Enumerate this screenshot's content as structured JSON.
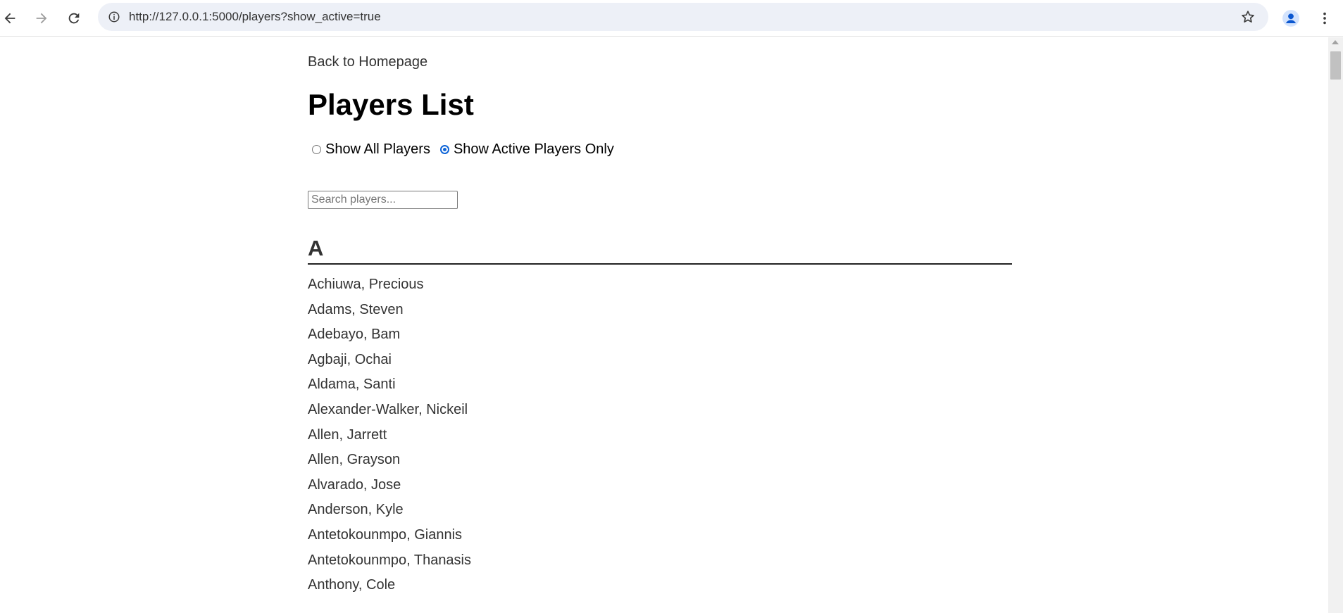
{
  "browser": {
    "url": "http://127.0.0.1:5000/players?show_active=true"
  },
  "page": {
    "back_link": "Back to Homepage",
    "title": "Players List",
    "filters": {
      "all_label": "Show All Players",
      "active_label": "Show Active Players Only",
      "selected": "active"
    },
    "search": {
      "placeholder": "Search players...",
      "value": ""
    },
    "letter": "A",
    "players": [
      "Achiuwa, Precious",
      "Adams, Steven",
      "Adebayo, Bam",
      "Agbaji, Ochai",
      "Aldama, Santi",
      "Alexander-Walker, Nickeil",
      "Allen, Jarrett",
      "Allen, Grayson",
      "Alvarado, Jose",
      "Anderson, Kyle",
      "Antetokounmpo, Giannis",
      "Antetokounmpo, Thanasis",
      "Anthony, Cole"
    ]
  },
  "colors": {
    "accent": "#0f65d8",
    "omnibox_bg": "#edf0f7",
    "text": "#333333"
  }
}
